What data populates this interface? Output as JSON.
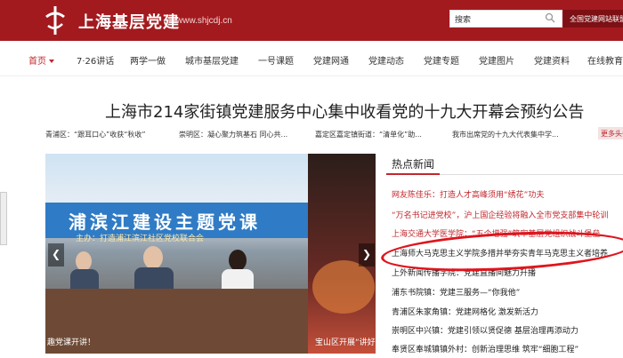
{
  "header": {
    "site_title": "上海基层党建",
    "site_url": "www.shjcdj.cn",
    "search_placeholder": "搜索",
    "search_scope_button": "全国党建网站联盟"
  },
  "nav": {
    "items": [
      {
        "label": "首页",
        "active": true
      },
      {
        "label": "7·26讲话"
      },
      {
        "label": "两学一做"
      },
      {
        "label": "城市基层党建"
      },
      {
        "label": "一号课题"
      },
      {
        "label": "党建网通"
      },
      {
        "label": "党建动态"
      },
      {
        "label": "党建专题"
      },
      {
        "label": "党建图片"
      },
      {
        "label": "党建资料"
      },
      {
        "label": "在线教育"
      }
    ]
  },
  "headline": "上海市214家街镇党建服务中心集中收看党的十九大开幕会预约公告",
  "ticker": {
    "items": [
      "青浦区：“跟耳口心”收获“秋收”",
      "崇明区：凝心聚力筑基石 同心共...",
      "嘉定区嘉定镇街道：“清单化”助...",
      "我市出席党的十九大代表集中学..."
    ],
    "more_label": "更多头条"
  },
  "slider": {
    "banner_title": "浦滨江建设主题党课",
    "banner_subtitle": "主办：打造浦江滨江社区党校联合会",
    "caption_main": "趣党课开讲！",
    "caption_side": "宝山区开展“讲好中",
    "prev_symbol": "❮",
    "next_symbol": "❯"
  },
  "hot_news": {
    "title": "热点新闻",
    "items": [
      {
        "text": "网友陈佳乐：打造人才高峰须用“绣花”功夫",
        "color": "red"
      },
      {
        "text": "“万名书记进党校”，沪上国企经验将融入全市党支部集中轮训",
        "color": "red"
      },
      {
        "text": "上海交通大学医学院：“五个增强”筑牢基层党组织战斗堡垒",
        "color": "red"
      },
      {
        "text": "上海师大马克思主义学院多措并举夯实青年马克思主义者培养",
        "color": "black"
      },
      {
        "text": "上外新闻传播学院：党建直播间魅力升播",
        "color": "black"
      },
      {
        "text": "浦东书院镇：党建三服务—“你我他”",
        "color": "black"
      },
      {
        "text": "青浦区朱家角镇：党建网格化 激发新活力",
        "color": "black"
      },
      {
        "text": "崇明区中兴镇：党建引领以贤促德 基层治理再添动力",
        "color": "black"
      },
      {
        "text": "奉贤区奉城镇镇外村：创新治理思维 筑牢“细胞工程”",
        "color": "black"
      }
    ]
  },
  "colors": {
    "brand_red": "#a31a1e",
    "accent_red": "#c1272d",
    "highlight_ellipse": "#e0141c"
  }
}
